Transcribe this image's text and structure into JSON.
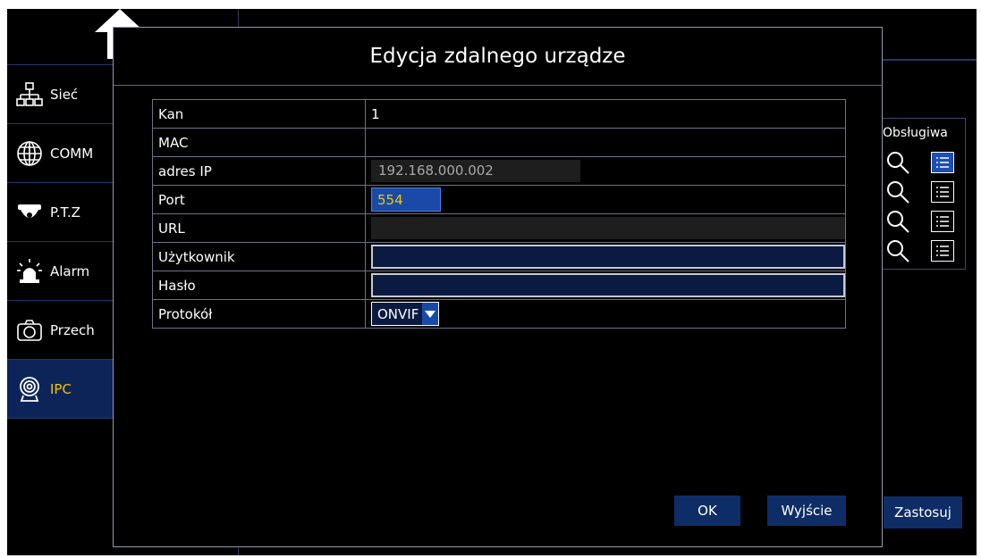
{
  "sidebar": {
    "items": [
      {
        "label": "Sieć",
        "icon": "network-icon"
      },
      {
        "label": "COMM",
        "icon": "globe-icon"
      },
      {
        "label": "P.T.Z",
        "icon": "dome-camera-icon"
      },
      {
        "label": "Alarm",
        "icon": "siren-icon"
      },
      {
        "label": "Przech",
        "icon": "camera-icon"
      },
      {
        "label": "IPC",
        "icon": "webcam-icon"
      }
    ],
    "active_item": "IPC"
  },
  "right_panel": {
    "support_header": "Obsługiwa",
    "apply_label": "Zastosuj",
    "rows": 4
  },
  "dialog": {
    "title": "Edycja zdalnego urządze",
    "fields": {
      "channel_label": "Kan",
      "channel_value": "1",
      "mac_label": "MAC",
      "mac_value": "",
      "ip_label": "adres IP",
      "ip_value": "192.168.000.002",
      "port_label": "Port",
      "port_value": "554",
      "url_label": "URL",
      "url_value": "",
      "user_label": "Użytkownik",
      "user_value": "",
      "password_label": "Hasło",
      "password_value": "",
      "protocol_label": "Protokół",
      "protocol_value": "ONVIF"
    },
    "ok_label": "OK",
    "exit_label": "Wyjście"
  },
  "colors": {
    "accent_blue": "#1a4aa8",
    "active_text": "#f2c500",
    "button_bg": "#0e2d66"
  }
}
